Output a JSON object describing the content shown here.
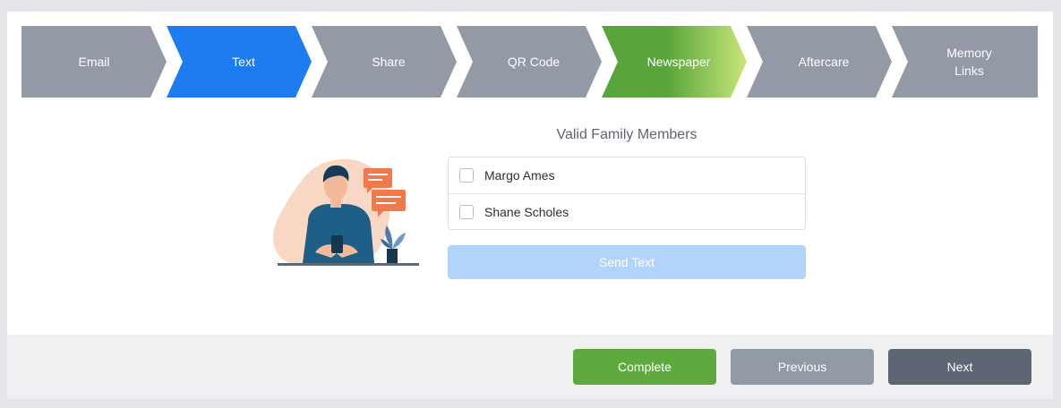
{
  "steps": [
    {
      "label": "Email",
      "color": "#939aa6"
    },
    {
      "label": "Text",
      "color": "#1c7cf0"
    },
    {
      "label": "Share",
      "color": "#939aa6"
    },
    {
      "label": "QR Code",
      "color": "#939aa6"
    },
    {
      "label": "Newspaper",
      "color": "#5aa53b"
    },
    {
      "label": "Aftercare",
      "color": "#939aa6"
    },
    {
      "label": "Memory Links",
      "line1": "Memory",
      "line2": "Links",
      "color": "#939aa6"
    }
  ],
  "family": {
    "title": "Valid Family Members",
    "members": [
      {
        "name": "Margo Ames",
        "checked": false
      },
      {
        "name": "Shane Scholes",
        "checked": false
      }
    ],
    "send_label": "Send Text",
    "send_enabled": false
  },
  "footer": {
    "complete_label": "Complete",
    "previous_label": "Previous",
    "next_label": "Next"
  },
  "colors": {
    "active_step": "#1c7cf0",
    "complete_step": "#5aa53b",
    "inactive_step": "#939aa6",
    "complete_button": "#5eaa3f",
    "previous_button": "#929aa6",
    "next_button": "#5e6573",
    "send_button_disabled": "#b3d4fa"
  }
}
